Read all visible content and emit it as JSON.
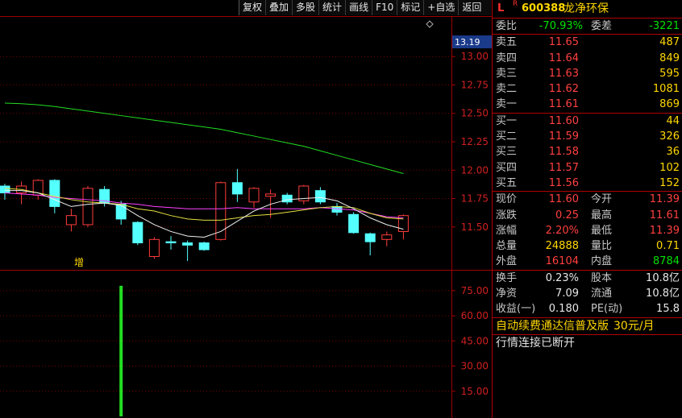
{
  "toolbar": {
    "buttons": [
      "复权",
      "叠加",
      "多股",
      "统计",
      "画线",
      "F10",
      "标记",
      "+自选",
      "返回"
    ]
  },
  "stock": {
    "market": "L",
    "badge": "R",
    "code": "600388",
    "name": "龙净环保"
  },
  "quote": {
    "weibi_label": "委比",
    "weibi": "-70.93%",
    "weicha_label": "委差",
    "weicha": "-3221",
    "asks": [
      {
        "label": "卖五",
        "price": "11.65",
        "vol": "487"
      },
      {
        "label": "卖四",
        "price": "11.64",
        "vol": "849"
      },
      {
        "label": "卖三",
        "price": "11.63",
        "vol": "595"
      },
      {
        "label": "卖二",
        "price": "11.62",
        "vol": "1081"
      },
      {
        "label": "卖一",
        "price": "11.61",
        "vol": "869"
      }
    ],
    "bids": [
      {
        "label": "买一",
        "price": "11.60",
        "vol": "44"
      },
      {
        "label": "买二",
        "price": "11.59",
        "vol": "326"
      },
      {
        "label": "买三",
        "price": "11.58",
        "vol": "36"
      },
      {
        "label": "买四",
        "price": "11.57",
        "vol": "102"
      },
      {
        "label": "买五",
        "price": "11.56",
        "vol": "152"
      }
    ],
    "stats": [
      {
        "l1": "现价",
        "v1": "11.60",
        "c1": "red",
        "l2": "今开",
        "v2": "11.39",
        "c2": "red"
      },
      {
        "l1": "涨跌",
        "v1": "0.25",
        "c1": "red",
        "l2": "最高",
        "v2": "11.61",
        "c2": "red"
      },
      {
        "l1": "涨幅",
        "v1": "2.20%",
        "c1": "red",
        "l2": "最低",
        "v2": "11.39",
        "c2": "red"
      },
      {
        "l1": "总量",
        "v1": "24888",
        "c1": "yel",
        "l2": "量比",
        "v2": "0.71",
        "c2": "yel"
      },
      {
        "l1": "外盘",
        "v1": "16104",
        "c1": "red",
        "l2": "内盘",
        "v2": "8784",
        "c2": "grn"
      }
    ],
    "fund": [
      {
        "l1": "换手",
        "v1": "0.23%",
        "l2": "股本",
        "v2": "10.8亿"
      },
      {
        "l1": "净资",
        "v1": "7.09",
        "l2": "流通",
        "v2": "10.8亿"
      },
      {
        "l1": "收益(一)",
        "v1": "0.180",
        "l2": "PE(动)",
        "v2": "15.8"
      }
    ],
    "notice": "自动续费通达信普及版",
    "notice_price": "30元/月",
    "status": "行情连接已断开"
  },
  "chart_data": {
    "type": "candlestick",
    "current_price_label": "13.19",
    "y_ticks": [
      "13.00",
      "12.75",
      "12.50",
      "12.25",
      "12.00",
      "11.75",
      "11.50"
    ],
    "y_range": [
      11.3,
      13.19
    ],
    "marker_text": "增",
    "candles": [
      {
        "o": 11.86,
        "c": 11.8,
        "h": 11.88,
        "l": 11.74
      },
      {
        "o": 11.8,
        "c": 11.86,
        "h": 11.9,
        "l": 11.7
      },
      {
        "o": 11.78,
        "c": 11.91,
        "h": 11.92,
        "l": 11.74
      },
      {
        "o": 11.91,
        "c": 11.68,
        "h": 11.92,
        "l": 11.62
      },
      {
        "o": 11.52,
        "c": 11.6,
        "h": 11.66,
        "l": 11.46
      },
      {
        "o": 11.52,
        "c": 11.84,
        "h": 11.86,
        "l": 11.5
      },
      {
        "o": 11.83,
        "c": 11.71,
        "h": 11.86,
        "l": 11.68
      },
      {
        "o": 11.7,
        "c": 11.57,
        "h": 11.73,
        "l": 11.52
      },
      {
        "o": 11.54,
        "c": 11.36,
        "h": 11.55,
        "l": 11.34
      },
      {
        "o": 11.24,
        "c": 11.39,
        "h": 11.41,
        "l": 11.22
      },
      {
        "o": 11.37,
        "c": 11.36,
        "h": 11.42,
        "l": 11.3
      },
      {
        "o": 11.36,
        "c": 11.34,
        "h": 11.38,
        "l": 11.2
      },
      {
        "o": 11.36,
        "c": 11.3,
        "h": 11.37,
        "l": 11.29
      },
      {
        "o": 11.39,
        "c": 11.89,
        "h": 11.9,
        "l": 11.38
      },
      {
        "o": 11.89,
        "c": 11.79,
        "h": 12.01,
        "l": 11.72
      },
      {
        "o": 11.72,
        "c": 11.84,
        "h": 11.85,
        "l": 11.67
      },
      {
        "o": 11.77,
        "c": 11.79,
        "h": 11.83,
        "l": 11.58
      },
      {
        "o": 11.78,
        "c": 11.72,
        "h": 11.8,
        "l": 11.7
      },
      {
        "o": 11.73,
        "c": 11.86,
        "h": 11.87,
        "l": 11.7
      },
      {
        "o": 11.82,
        "c": 11.72,
        "h": 11.85,
        "l": 11.7
      },
      {
        "o": 11.68,
        "c": 11.63,
        "h": 11.71,
        "l": 11.6
      },
      {
        "o": 11.61,
        "c": 11.45,
        "h": 11.63,
        "l": 11.44
      },
      {
        "o": 11.44,
        "c": 11.37,
        "h": 11.45,
        "l": 11.25
      },
      {
        "o": 11.39,
        "c": 11.43,
        "h": 11.46,
        "l": 11.33
      },
      {
        "o": 11.46,
        "c": 11.6,
        "h": 11.61,
        "l": 11.39
      }
    ],
    "ma_green": [
      12.59,
      12.585,
      12.575,
      12.56,
      12.54,
      12.52,
      12.5,
      12.48,
      12.46,
      12.44,
      12.42,
      12.4,
      12.38,
      12.36,
      12.33,
      12.3,
      12.27,
      12.24,
      12.21,
      12.17,
      12.13,
      12.09,
      12.05,
      12.01,
      11.97
    ],
    "ma_magenta": [
      11.8,
      11.79,
      11.78,
      11.76,
      11.75,
      11.74,
      11.73,
      11.71,
      11.7,
      11.68,
      11.67,
      11.66,
      11.66,
      11.66,
      11.67,
      11.66,
      11.66,
      11.66,
      11.66,
      11.67,
      11.66,
      11.65,
      11.62,
      11.59,
      11.58
    ],
    "ma_yellow": [
      11.84,
      11.83,
      11.8,
      11.77,
      11.74,
      11.72,
      11.71,
      11.7,
      11.66,
      11.64,
      11.6,
      11.57,
      11.56,
      11.56,
      11.58,
      11.6,
      11.61,
      11.63,
      11.65,
      11.67,
      11.68,
      11.67,
      11.62,
      11.58,
      11.57
    ],
    "ma_white": [
      11.82,
      11.82,
      11.8,
      11.74,
      11.68,
      11.7,
      11.71,
      11.69,
      11.6,
      11.52,
      11.46,
      11.42,
      11.41,
      11.46,
      11.55,
      11.64,
      11.7,
      11.74,
      11.75,
      11.76,
      11.73,
      11.66,
      11.58,
      11.52,
      11.48
    ],
    "volume": {
      "y_ticks": [
        "75.00",
        "60.00",
        "45.00",
        "30.00",
        "15.00"
      ],
      "y_range": [
        0,
        85
      ],
      "bars": [
        {
          "index": 7,
          "value": 75
        }
      ]
    }
  }
}
